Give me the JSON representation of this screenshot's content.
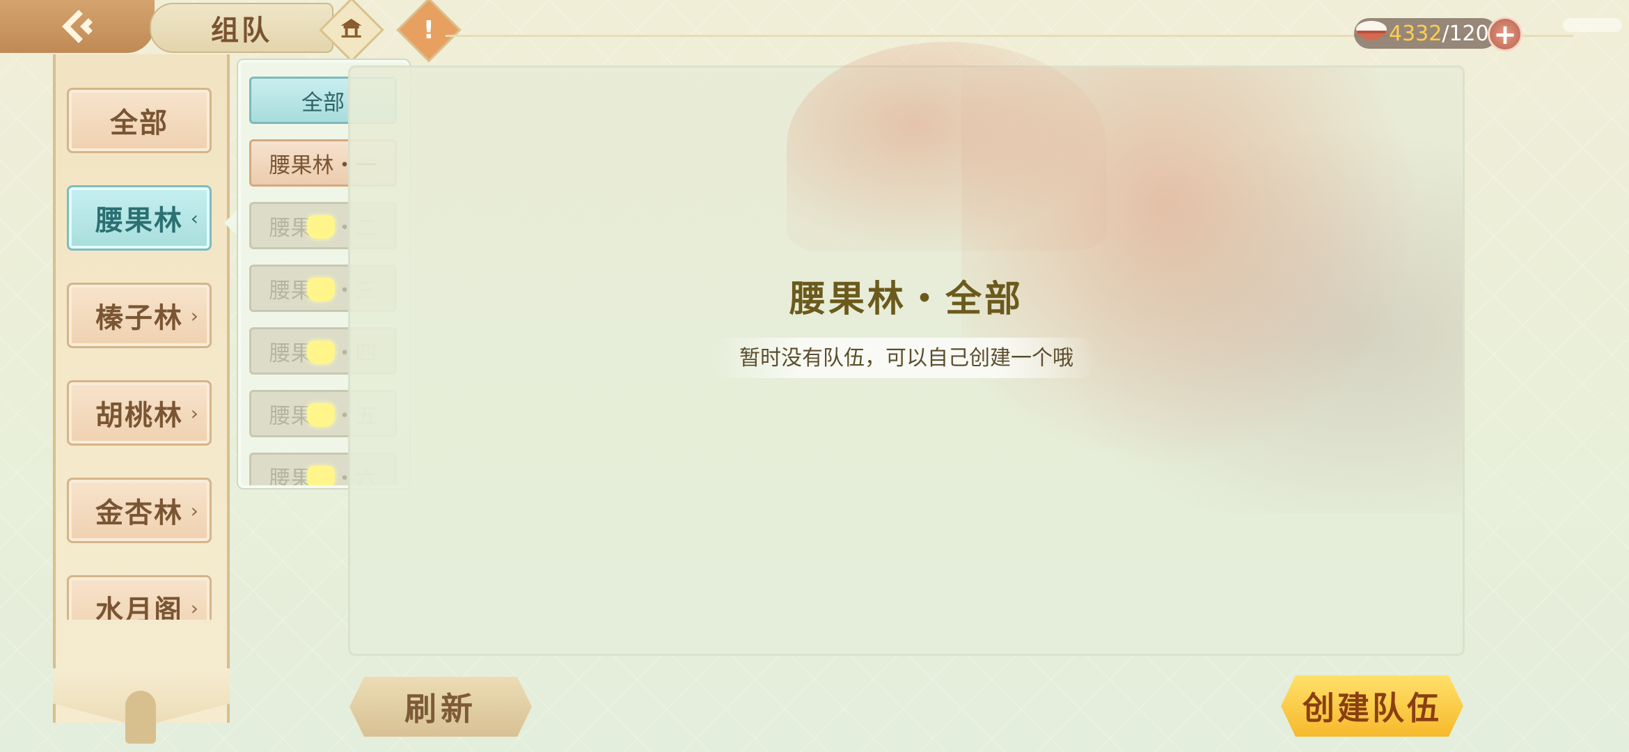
{
  "header": {
    "title": "组队",
    "icon_home": "pavilion-icon",
    "icon_notice": "!",
    "currency": {
      "current": "4332",
      "max": "/120",
      "icon": "rice-bowl-icon",
      "add": "+"
    }
  },
  "categories": [
    {
      "label": "全部",
      "active": false,
      "chevron": ""
    },
    {
      "label": "腰果林",
      "active": true,
      "chevron": "‹"
    },
    {
      "label": "榛子林",
      "active": false,
      "chevron": "›"
    },
    {
      "label": "胡桃林",
      "active": false,
      "chevron": "›"
    },
    {
      "label": "金杏林",
      "active": false,
      "chevron": "›"
    },
    {
      "label": "水月阁",
      "active": false,
      "chevron": "›"
    }
  ],
  "submenu": [
    {
      "label": "全部",
      "state": "sel"
    },
    {
      "label": "腰果林・一",
      "state": "open"
    },
    {
      "label": "腰果林・二",
      "state": "lock"
    },
    {
      "label": "腰果林・三",
      "state": "lock"
    },
    {
      "label": "腰果林・四",
      "state": "lock"
    },
    {
      "label": "腰果林・五",
      "state": "lock"
    },
    {
      "label": "腰果林・六",
      "state": "lock"
    }
  ],
  "panel": {
    "title": "腰果林・全部",
    "message": "暂时没有队伍，可以自己创建一个哦"
  },
  "buttons": {
    "refresh": "刷新",
    "create": "创建队伍"
  }
}
